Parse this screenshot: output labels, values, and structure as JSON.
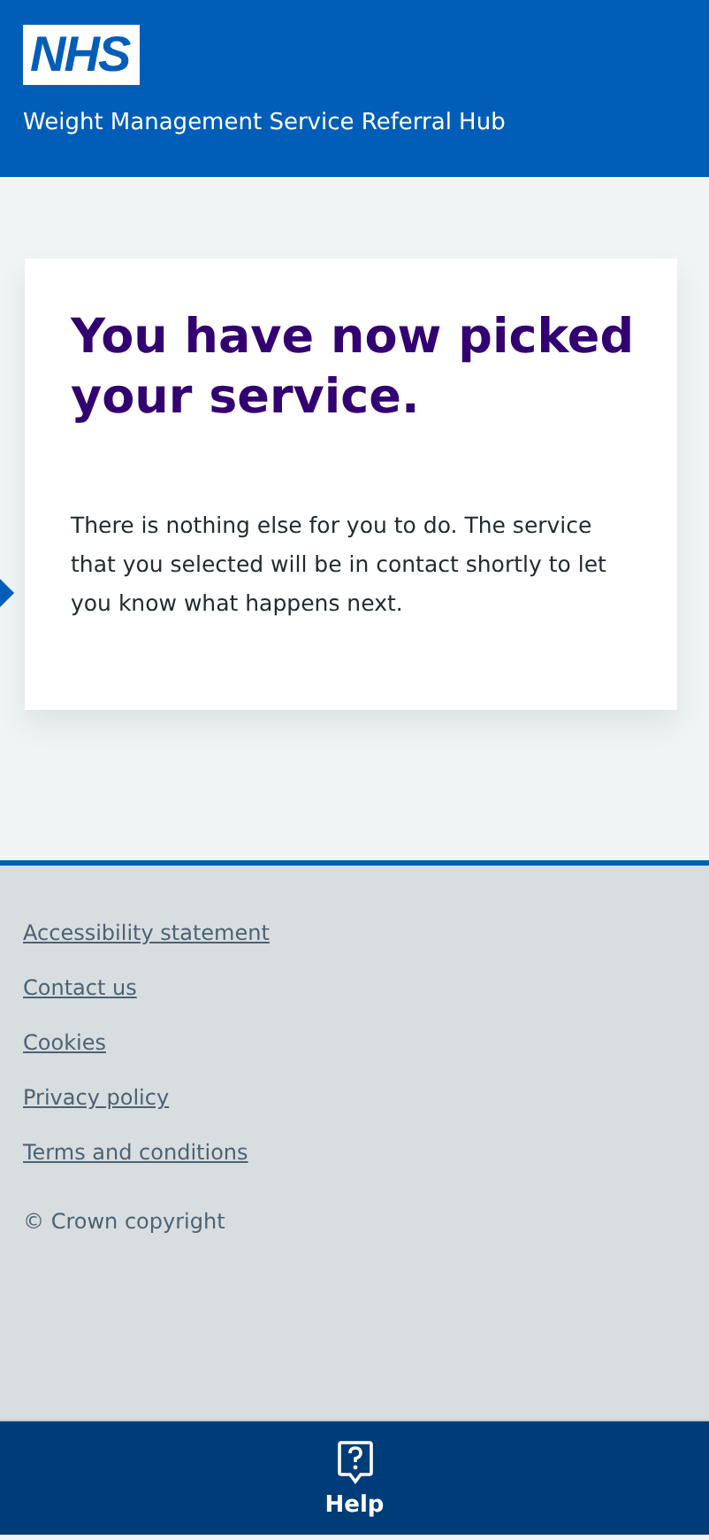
{
  "header": {
    "logo": "NHS",
    "service_name": "Weight Management Service Referral Hub"
  },
  "card": {
    "heading": "You have now picked your service.",
    "body": "There is nothing else for you to do. The service that you selected will be in contact shortly to let you know what happens next."
  },
  "footer": {
    "links": [
      "Accessibility statement",
      "Contact us",
      "Cookies",
      "Privacy policy",
      "Terms and conditions"
    ],
    "copyright": "© Crown copyright"
  },
  "bottom_bar": {
    "items": [
      {
        "label": "Help"
      }
    ]
  }
}
